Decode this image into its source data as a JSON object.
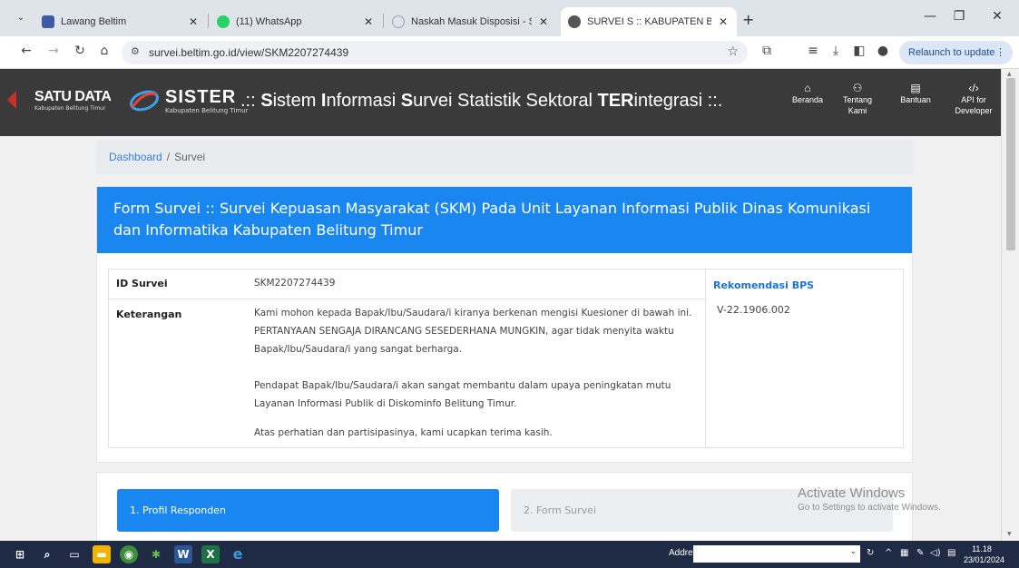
{
  "browser": {
    "tabs": [
      {
        "title": "Lawang Beltim",
        "color": "#3b5aa8",
        "active": false
      },
      {
        "title": "(11) WhatsApp",
        "color": "#25d366",
        "active": false
      },
      {
        "title": "Naskah Masuk Disposisi - SRIKA",
        "color": "#9aa3ad",
        "active": false
      },
      {
        "title": "SURVEI S :: KABUPATEN BELITUNG",
        "color": "#555555",
        "active": true
      }
    ],
    "url": "survei.beltim.go.id/view/SKM2207274439",
    "relaunch_label": "Relaunch to update"
  },
  "site": {
    "logo_satu": "SATU DATA",
    "logo_satu_sub": "Kabupaten Belitung Timur",
    "logo_sister": "SISTER",
    "logo_sister_sub": "Kabupaten Belitung Timur",
    "title_parts": [
      ".:: ",
      "S",
      "istem ",
      "I",
      "nformasi ",
      "S",
      "urvei Statistik Sektoral ",
      "TER",
      "integrasi ::."
    ],
    "nav": [
      {
        "label": "Beranda",
        "icon": "home-icon"
      },
      {
        "label": "Tentang Kami",
        "icon": "users-icon"
      },
      {
        "label": "Bantuan",
        "icon": "help-icon"
      },
      {
        "label": "API for Developer",
        "icon": "code-icon"
      }
    ]
  },
  "breadcrumb": {
    "home": "Dashboard",
    "sep": "/",
    "current": "Survei"
  },
  "form": {
    "title": "Form Survei :: Survei Kepuasan Masyarakat (SKM) Pada Unit Layanan Informasi Publik Dinas Komunikasi dan Informatika Kabupaten Belitung Timur",
    "id_label": "ID Survei",
    "id_value": "SKM2207274439",
    "ket_label": "Keterangan",
    "ket_p1": "Kami mohon kepada Bapak/Ibu/Saudara/i kiranya berkenan mengisi Kuesioner di bawah ini. PERTANYAAN SENGAJA DIRANCANG SESEDERHANA MUNGKIN, agar tidak menyita waktu Bapak/Ibu/Saudara/i yang sangat berharga.",
    "ket_p2": "Pendapat Bapak/Ibu/Saudara/i akan sangat membantu dalam upaya peningkatan mutu Layanan Informasi Publik di Diskominfo Belitung Timur.",
    "ket_p3": "Atas perhatian dan partisipasinya, kami ucapkan terima kasih.",
    "rec_title": "Rekomendasi BPS",
    "rec_value": "V-22.1906.002"
  },
  "steps": [
    "1. Profil Responden",
    "2. Form Survei"
  ],
  "watermark": {
    "line1": "Activate Windows",
    "line2": "Go to Settings to activate Windows."
  },
  "taskbar": {
    "address_label": "Address",
    "time": "11.18",
    "date": "23/01/2024"
  },
  "colors": {
    "header_bg": "#3a3a3a",
    "accent": "#1a86f0",
    "taskbar": "#1f2a44"
  }
}
